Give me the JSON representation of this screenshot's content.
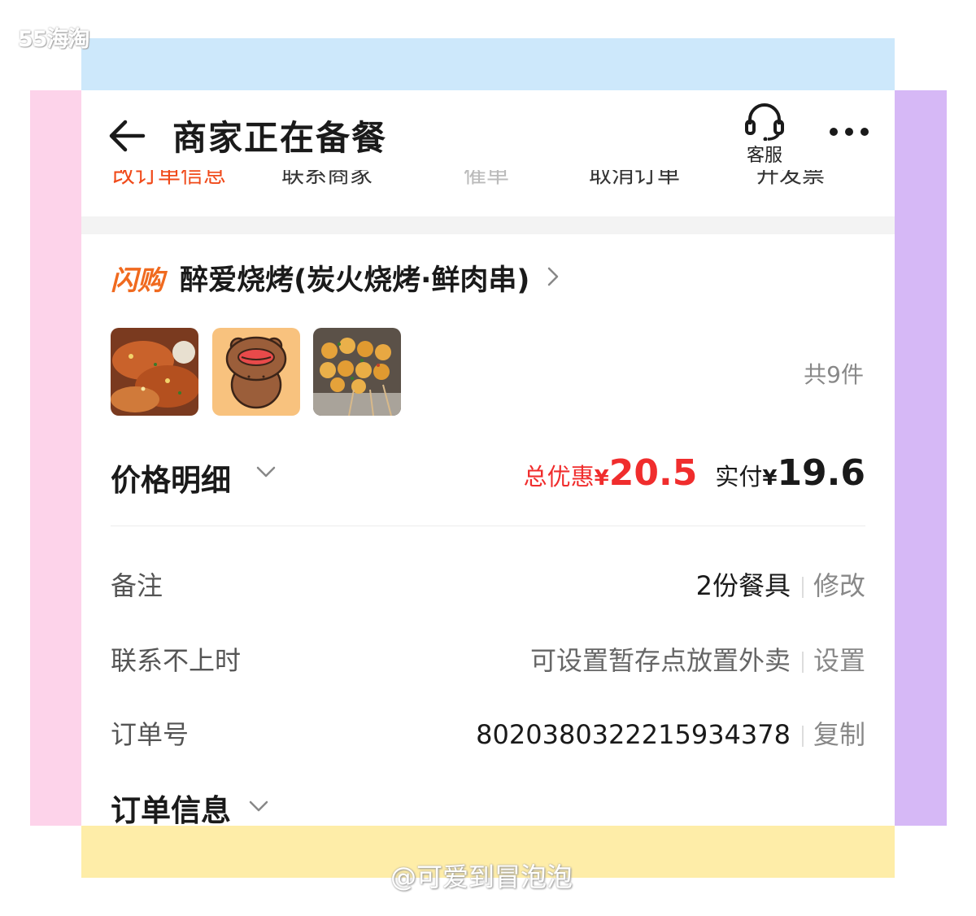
{
  "watermark": {
    "logo": "55海淘",
    "user": "@可爱到冒泡泡"
  },
  "colors": {
    "accent_red": "#f02d2d",
    "brand_orange": "#f06a1f",
    "deco_top": "#cde8fb",
    "deco_left": "#fdd3ea",
    "deco_right": "#d6b8f6",
    "deco_bottom": "#feeda8"
  },
  "header": {
    "title": "商家正在备餐",
    "service_label": "客服",
    "back_icon": "arrow-left-icon",
    "more_icon": "more-dots-icon",
    "service_icon": "headset-icon"
  },
  "actions": [
    "改订单信息",
    "联系商家",
    "催单",
    "取消订单",
    "开发票"
  ],
  "shop": {
    "brand": "闪购",
    "name": "醉爱烧烤(炭火烧烤·鲜肉串)"
  },
  "items": {
    "count_label": "共9件",
    "thumbnails": [
      "grilled-meat-thumbnail",
      "cartoon-bear-thumbnail",
      "potato-skewers-thumbnail"
    ]
  },
  "price": {
    "label": "价格明细",
    "discount_label": "总优惠",
    "currency": "¥",
    "discount_value": "20.5",
    "paid_label": "实付",
    "paid_value": "19.6"
  },
  "rows": [
    {
      "label": "备注",
      "value": "2份餐具",
      "action": "修改"
    },
    {
      "label": "联系不上时",
      "value": "可设置暂存点放置外卖",
      "action": "设置"
    },
    {
      "label": "订单号",
      "value": "8020380322215934378",
      "action": "复制"
    }
  ],
  "order_info": {
    "label": "订单信息"
  }
}
